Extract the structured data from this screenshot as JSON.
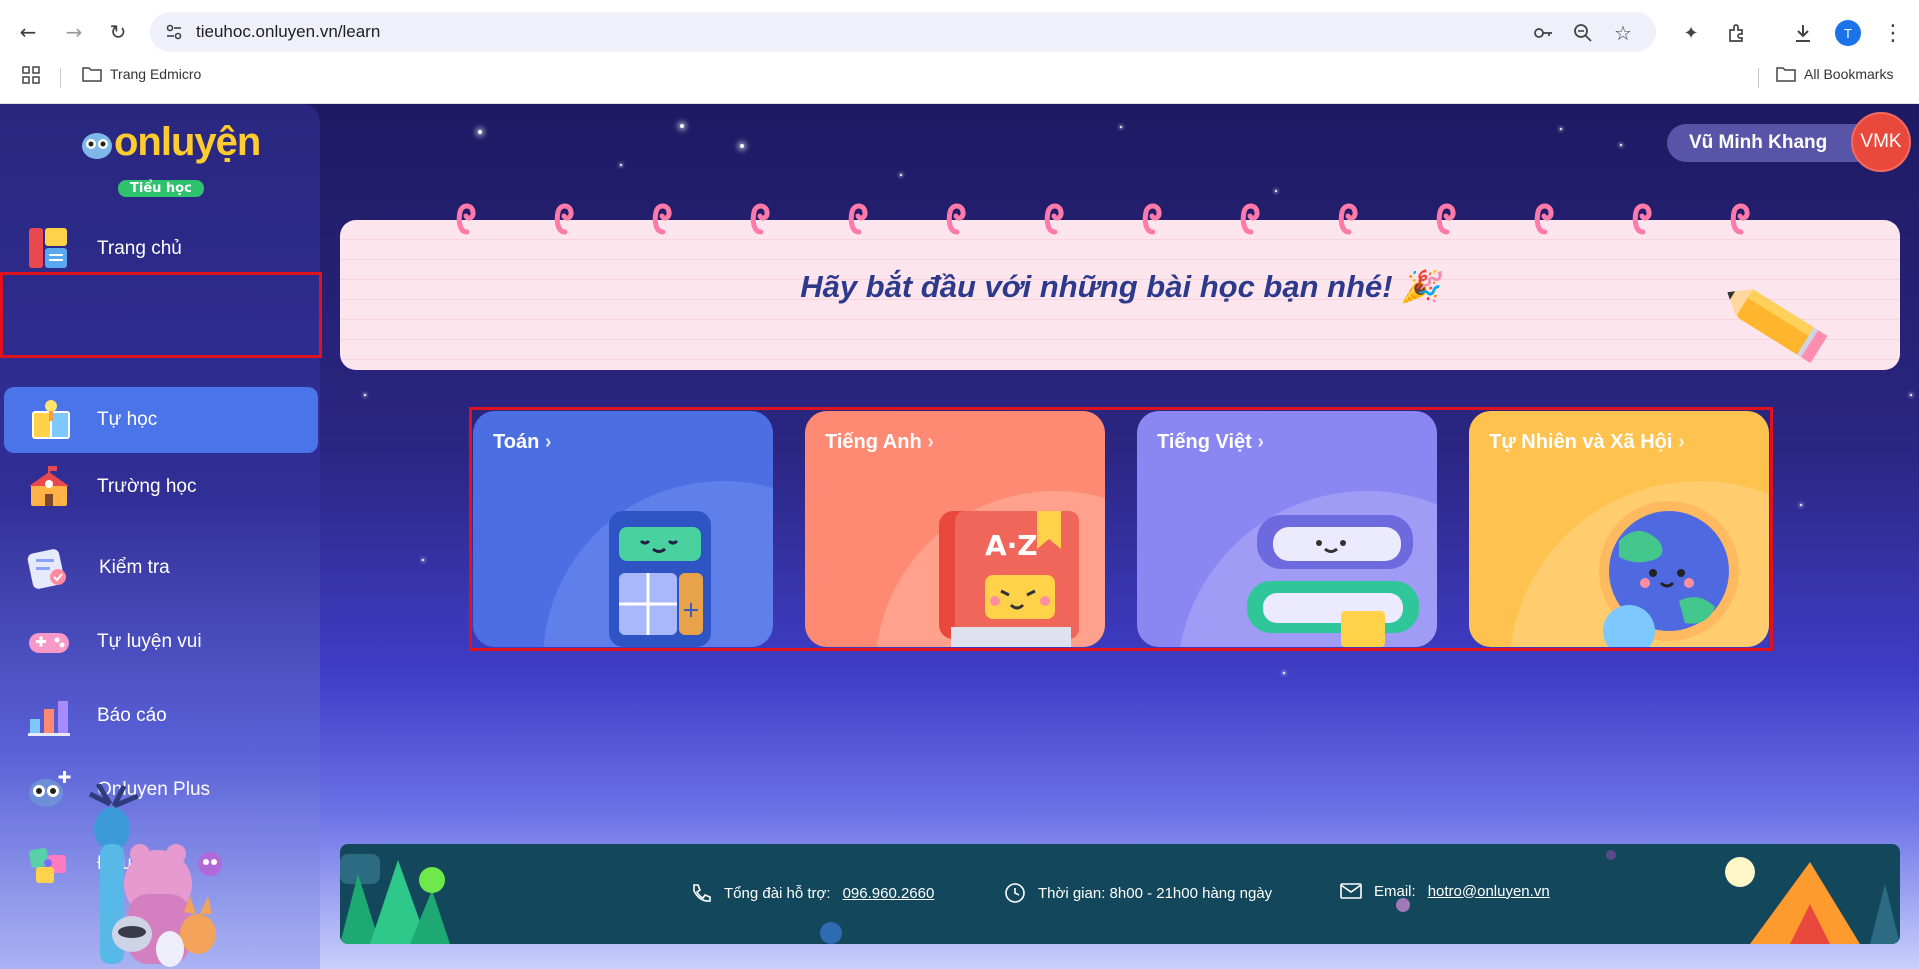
{
  "browser": {
    "url": "tieuhoc.onluyen.vn/learn",
    "profile_initial": "T",
    "bookmark_folder": "Trang Edmicro",
    "all_bookmarks": "All Bookmarks"
  },
  "logo": {
    "text": "onluyện",
    "badge": "Tiểu học"
  },
  "sidebar": {
    "items": [
      {
        "label": "Trang chủ",
        "icon": "home-book-icon"
      },
      {
        "label": "Tự học",
        "icon": "self-study-icon",
        "active": true
      },
      {
        "label": "Trường học",
        "icon": "school-icon"
      },
      {
        "label": "Kiểm tra",
        "icon": "test-icon"
      },
      {
        "label": "Tự luyện vui",
        "icon": "gamepad-icon"
      },
      {
        "label": "Báo cáo",
        "icon": "report-icon"
      },
      {
        "label": "Onluyen Plus",
        "icon": "owl-plus-icon"
      },
      {
        "label": "Đấu trí",
        "icon": "puzzle-icon"
      }
    ]
  },
  "user": {
    "name": "Vũ Minh Khang",
    "initials": "VMK"
  },
  "banner": {
    "text": "Hãy bắt đầu với những bài học bạn nhé! 🎉"
  },
  "subjects": [
    {
      "title": "Toán",
      "color": "#4b6ee3"
    },
    {
      "title": "Tiếng Anh",
      "color": "#ff8a74"
    },
    {
      "title": "Tiếng Việt",
      "color": "#8a86f2"
    },
    {
      "title": "Tự Nhiên và Xã Hội",
      "color": "#ffc24f"
    }
  ],
  "footer": {
    "hotline_label": "Tổng đài hỗ trợ:",
    "hotline": "096.960.2660",
    "hours": "Thời gian: 8h00 - 21h00 hàng ngày",
    "email_label": "Email:",
    "email": "hotro@onluyen.vn"
  },
  "colors": {
    "active_menu": "#4a74e8",
    "highlight": "#e0121f",
    "footer_bg": "#13485c"
  }
}
